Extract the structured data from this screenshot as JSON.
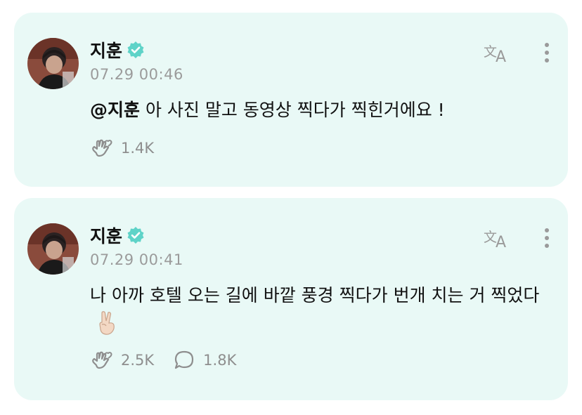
{
  "posts": [
    {
      "author": "지훈",
      "verified": true,
      "timestamp": "07.29 00:46",
      "mention": "@지훈",
      "text": " 아 사진 말고 동영상 찍다가 찍힌거에요 !",
      "stats": [
        {
          "icon": "heart-hand-icon",
          "value": "1.4K"
        }
      ]
    },
    {
      "author": "지훈",
      "verified": true,
      "timestamp": "07.29 00:41",
      "text": "나 아까 호텔 오는 길에 바깥 풍경 찍다가 번개 치는 거 찍었다",
      "emoji": "victory-hand-emoji",
      "stats": [
        {
          "icon": "heart-hand-icon",
          "value": "2.5K"
        },
        {
          "icon": "comment-bubble-icon",
          "value": "1.8K"
        }
      ]
    }
  ],
  "colors": {
    "card_background": "#e9f9f6",
    "verified_badge": "#5fd3c8",
    "muted_text": "#9b9b9b"
  }
}
